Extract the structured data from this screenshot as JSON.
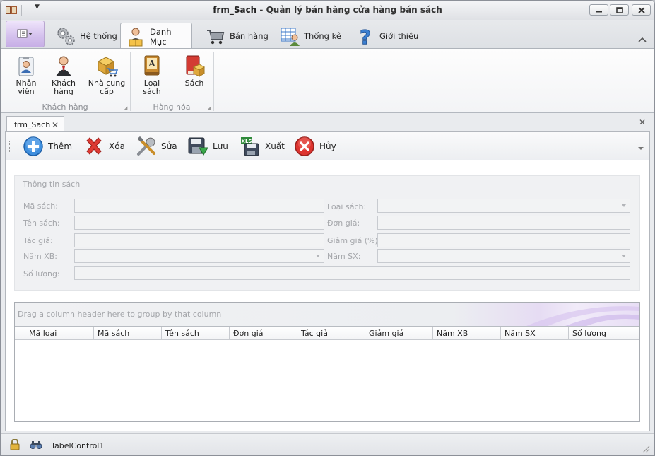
{
  "window": {
    "form_name": "frm_Sach",
    "title_separator": " - ",
    "title_text": "Quản lý bán hàng cửa hàng bán sách"
  },
  "ribbon_tabs": [
    {
      "label": "Hệ thống",
      "icon": "gears-icon"
    },
    {
      "label": "Danh Mục",
      "icon": "person-book-icon"
    },
    {
      "label": "Bán hàng",
      "icon": "shopping-cart-icon"
    },
    {
      "label": "Thống kê",
      "icon": "spreadsheet-person-icon"
    },
    {
      "label": "Giới thiệu",
      "icon": "help-icon"
    }
  ],
  "active_tab": "Danh Mục",
  "ribbon_groups": {
    "khach_hang": {
      "label": "Khách hàng",
      "buttons": [
        {
          "label_line1": "Nhân viên",
          "label_line2": "",
          "icon": "employee-icon"
        },
        {
          "label_line1": "Khách",
          "label_line2": "hàng",
          "icon": "customer-icon"
        },
        {
          "label_line1": "Nhà cung",
          "label_line2": "cấp",
          "icon": "supplier-icon"
        }
      ]
    },
    "hang_hoa": {
      "label": "Hàng hóa",
      "buttons": [
        {
          "label_line1": "Loại sách",
          "label_line2": "",
          "icon": "book-category-icon"
        },
        {
          "label_line1": "Sách",
          "label_line2": "",
          "icon": "book-icon"
        }
      ]
    }
  },
  "document_tab": {
    "label": "frm_Sach"
  },
  "toolbar": {
    "buttons": [
      {
        "label": "Thêm",
        "icon": "add-icon"
      },
      {
        "label": "Xóa",
        "icon": "delete-icon"
      },
      {
        "label": "Sửa",
        "icon": "tools-icon"
      },
      {
        "label": "Lưu",
        "icon": "save-icon"
      },
      {
        "label": "Xuất",
        "icon": "export-xls-icon"
      },
      {
        "label": "Hủy",
        "icon": "cancel-icon"
      }
    ]
  },
  "form": {
    "group_title": "Thông tin sách",
    "fields": {
      "ma_sach": {
        "label": "Mã sách:",
        "value": ""
      },
      "ten_sach": {
        "label": "Tên sách:",
        "value": ""
      },
      "tac_gia": {
        "label": "Tác giả:",
        "value": ""
      },
      "nam_xb": {
        "label": "Năm XB:",
        "value": ""
      },
      "so_luong": {
        "label": "Số lượng:",
        "value": ""
      },
      "loai_sach": {
        "label": "Loại sách:",
        "value": ""
      },
      "don_gia": {
        "label": "Đơn giá:",
        "value": ""
      },
      "giam_gia": {
        "label": "Giảm giá (%):",
        "value": ""
      },
      "nam_sx": {
        "label": "Năm SX:",
        "value": ""
      }
    }
  },
  "grid": {
    "group_panel_text": "Drag a column header here to group by that column",
    "columns": [
      "Mã loại",
      "Mã sách",
      "Tên sách",
      "Đơn giá",
      "Tác giả",
      "Giảm giá",
      "Năm XB",
      "Năm SX",
      "Số lượng"
    ],
    "rows": []
  },
  "statusbar": {
    "label": "labelControl1"
  },
  "colors": {
    "accent_purple": "#c7aee6",
    "add_blue": "#2a7fd4",
    "delete_red": "#d9302c",
    "cancel_red": "#d9302c"
  }
}
